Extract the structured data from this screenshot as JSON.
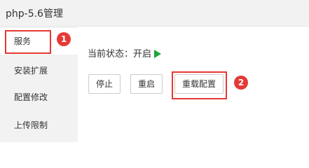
{
  "header": {
    "title": "php-5.6管理"
  },
  "sidebar": {
    "items": [
      {
        "label": "服务",
        "active": true
      },
      {
        "label": "安装扩展",
        "active": false
      },
      {
        "label": "配置修改",
        "active": false
      },
      {
        "label": "上传限制",
        "active": false
      }
    ]
  },
  "main": {
    "status_label": "当前状态：",
    "status_value": "开启",
    "buttons": {
      "stop": "停止",
      "restart": "重启",
      "reload": "重载配置"
    }
  },
  "annotations": {
    "badge_1": "1",
    "badge_2": "2"
  },
  "colors": {
    "highlight": "#e53935",
    "running": "#20a53a"
  },
  "icons": {
    "status": "play-icon"
  }
}
